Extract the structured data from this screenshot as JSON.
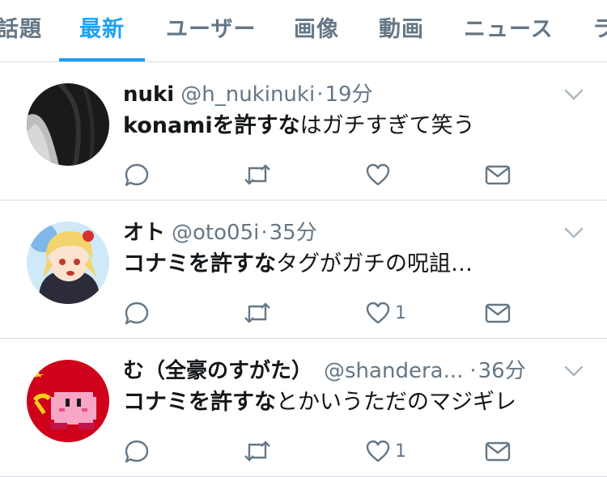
{
  "tabs": [
    {
      "label": "話題"
    },
    {
      "label": "最新"
    },
    {
      "label": "ユーザー"
    },
    {
      "label": "画像"
    },
    {
      "label": "動画"
    },
    {
      "label": "ニュース"
    },
    {
      "label": "ラ"
    }
  ],
  "active_tab": "最新",
  "colors": {
    "accent": "#1da1f2",
    "muted": "#657786",
    "divider": "#d6dbe0"
  },
  "tweets": [
    {
      "name": "nuki",
      "handle": "@h_nukinuki",
      "separator": "·",
      "time": "19分",
      "body_bold": "konamiを許すな",
      "body_rest": "はガチすぎて笑う",
      "retweet_count": "",
      "like_count": "",
      "avatar": "dark-hair-portrait"
    },
    {
      "name": "オト",
      "handle": "@oto05i",
      "separator": "·",
      "time": "35分",
      "body_bold": "コナミを許すな",
      "body_rest": "タグがガチの呪詛…",
      "retweet_count": "",
      "like_count": "1",
      "avatar": "anime-character"
    },
    {
      "name": "む（全豪のすがた）",
      "handle": "@shandera...",
      "separator": "·",
      "time": "36分",
      "body_bold": "コナミを許すな",
      "body_rest": "とかいうただのマジギレ",
      "retweet_count": "",
      "like_count": "1",
      "avatar": "pixel-kirby"
    }
  ]
}
